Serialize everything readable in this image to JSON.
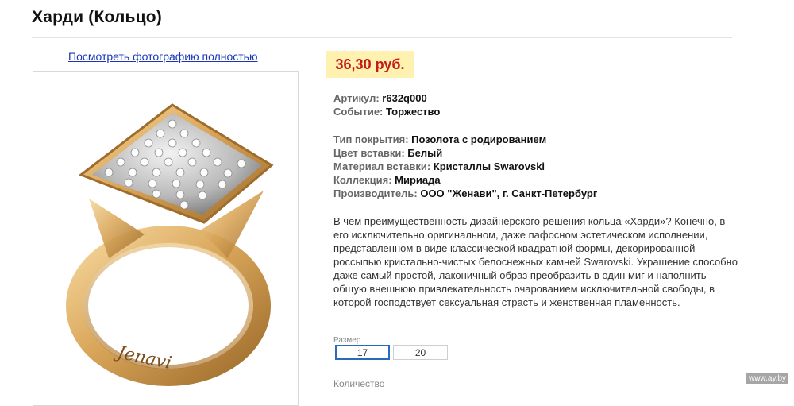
{
  "product": {
    "title": "Харди (Кольцо)",
    "view_photo_link": "Посмотреть фотографию полностью",
    "price": "36,30 руб."
  },
  "specs_group_1": [
    {
      "key": "Артикул:",
      "value": "r632q000"
    },
    {
      "key": "Событие:",
      "value": "Торжество"
    }
  ],
  "specs_group_2": [
    {
      "key": "Тип покрытия:",
      "value": "Позолота с родированием"
    },
    {
      "key": "Цвет вставки:",
      "value": "Белый"
    },
    {
      "key": "Материал вставки:",
      "value": "Кристаллы Swarovski"
    },
    {
      "key": "Коллекция:",
      "value": "Мириада"
    },
    {
      "key": "Производитель:",
      "value": "ООО \"Женави\", г. Санкт-Петербург"
    }
  ],
  "description": "В чем преимущественность дизайнерского решения кольца «Харди»? Конечно, в его исключительно оригинальном, даже пафосном эстетическом исполнении, представленном в виде классической квадратной формы, декорированной россыпью кристально-чистых белоснежных камней Swarovski. Украшение способно даже самый простой, лаконичный образ преобразить в один миг и наполнить общую внешнюю привлекательность очарованием исключительной свободы, в которой господствует сексуальная страсть и женственная пламенность.",
  "size": {
    "label": "Размер",
    "options": [
      "17",
      "20"
    ],
    "selected": "17"
  },
  "quantity_label": "Количество",
  "engraving_text": "Jenavi",
  "watermark": "www.ay.by",
  "colors": {
    "price_bg": "#fff2b0",
    "price_text": "#c41a1a",
    "link": "#1a35b8",
    "selected_border": "#2a6bb8"
  }
}
